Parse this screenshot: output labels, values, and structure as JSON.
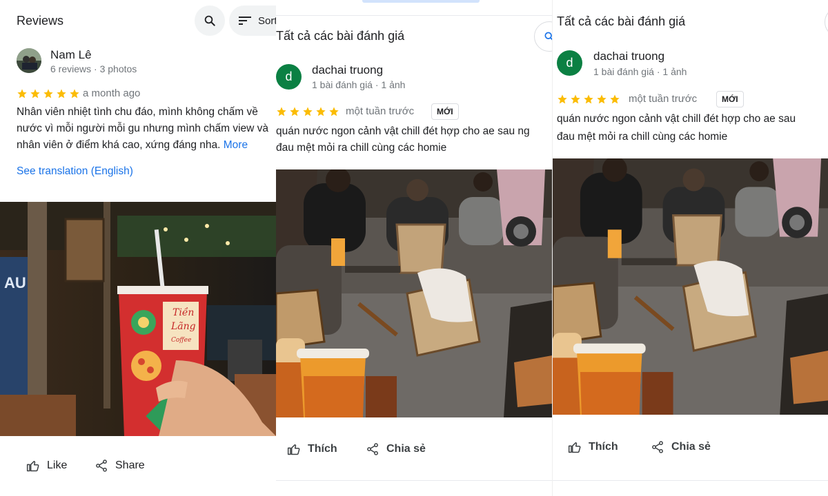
{
  "panel1": {
    "title": "Reviews",
    "search_icon": "search-icon",
    "sort_label": "Sort",
    "author": "Nam Lê",
    "meta": "6 reviews · 3 photos",
    "rating": 5,
    "time": "a month ago",
    "text_lines": [
      "Nhân viên nhiệt tình chu đáo, mình không chấm về",
      "nước vì mỗi người mỗi gu nhưng mình chấm view và",
      "nhân viên ở điểm khá cao, xứng đáng nha."
    ],
    "more": "More",
    "translation": "See translation (English)",
    "cup_text_1": "Tiền",
    "cup_text_2": "Lãng",
    "cup_text_3": "Coffee",
    "like": "Like",
    "share": "Share"
  },
  "panel2": {
    "title": "Tất cả các bài đánh giá",
    "author": "dachai truong",
    "avatar_letter": "d",
    "meta": "1 bài đánh giá · 1 ảnh",
    "rating": 5,
    "time": "một tuần trước",
    "badge": "MỚI",
    "text_lines": [
      "quán nước ngon cảnh vật chill đét hợp cho ae sau ng",
      "đau mệt mỏi ra chill cùng các homie"
    ],
    "like": "Thích",
    "share": "Chia sẻ"
  },
  "panel3": {
    "title": "Tất cả các bài đánh giá",
    "author": "dachai truong",
    "avatar_letter": "d",
    "meta": "1 bài đánh giá · 1 ảnh",
    "rating": 5,
    "time": "một tuần trước",
    "badge": "MỚI",
    "text_lines": [
      "quán nước ngon cảnh vật chill đét hợp cho ae sau",
      "đau mệt mỏi ra chill cùng các homie"
    ],
    "like": "Thích",
    "share": "Chia sẻ"
  },
  "colors": {
    "star": "#fbbc04",
    "link": "#1a73e8",
    "avatar_green": "#0b8043"
  }
}
